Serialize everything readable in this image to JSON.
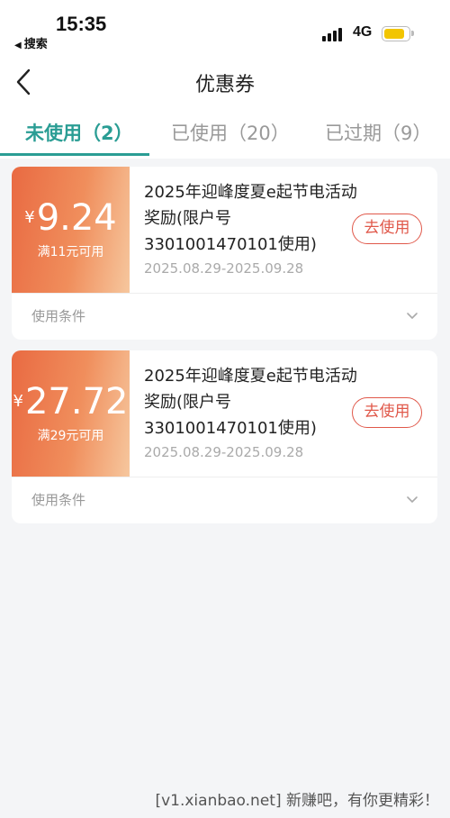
{
  "status_bar": {
    "time": "15:35",
    "back_app": "搜索",
    "network": "4G"
  },
  "header": {
    "title": "优惠券"
  },
  "tabs": [
    {
      "label": "未使用（2）",
      "active": true
    },
    {
      "label": "已使用（20）",
      "active": false
    },
    {
      "label": "已过期（9）",
      "active": false
    }
  ],
  "coupons": [
    {
      "currency": "¥",
      "amount": "9.24",
      "threshold": "满11元可用",
      "title": "2025年迎峰度夏e起节电活动奖励(限户号3301001470101使用)",
      "validity": "2025.08.29-2025.09.28",
      "action_label": "去使用",
      "conditions_label": "使用条件"
    },
    {
      "currency": "¥",
      "amount": "27.72",
      "threshold": "满29元可用",
      "title": "2025年迎峰度夏e起节电活动奖励(限户号3301001470101使用)",
      "validity": "2025.08.29-2025.09.28",
      "action_label": "去使用",
      "conditions_label": "使用条件"
    }
  ],
  "watermark": "[v1.xianbao.net] 新赚吧，有你更精彩！",
  "colors": {
    "accent": "#2a9d94",
    "button": "#e0584a",
    "coupon_gradient_start": "#e96a42",
    "coupon_gradient_end": "#f6c79e"
  }
}
